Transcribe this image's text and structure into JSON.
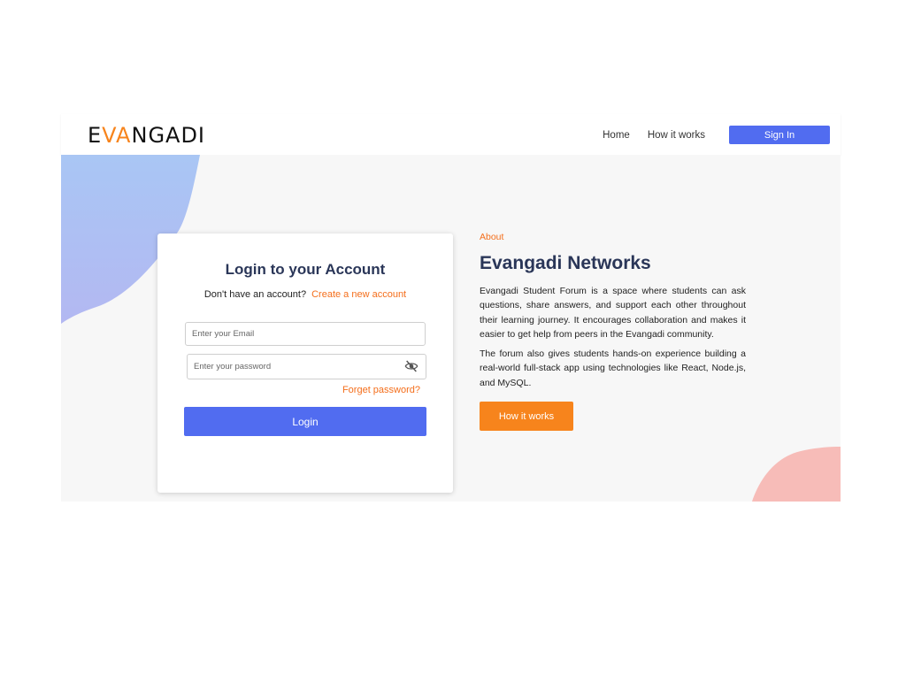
{
  "header": {
    "logo_left": "E",
    "logo_mid": "VA",
    "logo_right": "NGADI",
    "nav": [
      {
        "label": "Home"
      },
      {
        "label": "How it works"
      }
    ],
    "signin_label": "Sign In"
  },
  "login": {
    "title": "Login to your Account",
    "no_account_text": "Don't have an account?",
    "create_link": "Create a new account",
    "email_placeholder": "Enter your Email",
    "password_placeholder": "Enter your password",
    "forget_link": "Forget password?",
    "login_label": "Login"
  },
  "about": {
    "label": "About",
    "title": "Evangadi Networks",
    "paragraph1": "Evangadi Student Forum is a space where students can ask questions, share answers, and support each other throughout their learning journey. It encourages collaboration and makes it easier to get help from peers in the Evangadi community.",
    "paragraph2": "The forum also gives students hands-on experience building a real-world full-stack app using technologies like React, Node.js, and MySQL.",
    "button_label": "How it works"
  },
  "icons": {
    "password_toggle": "eye-off-icon"
  },
  "colors": {
    "primary": "#516cf0",
    "accent": "#f46e1b",
    "button_orange": "#f7841c",
    "title": "#2a3658",
    "blob_blue": "#a8c4f2",
    "blob_pink": "#f7bcb8"
  }
}
